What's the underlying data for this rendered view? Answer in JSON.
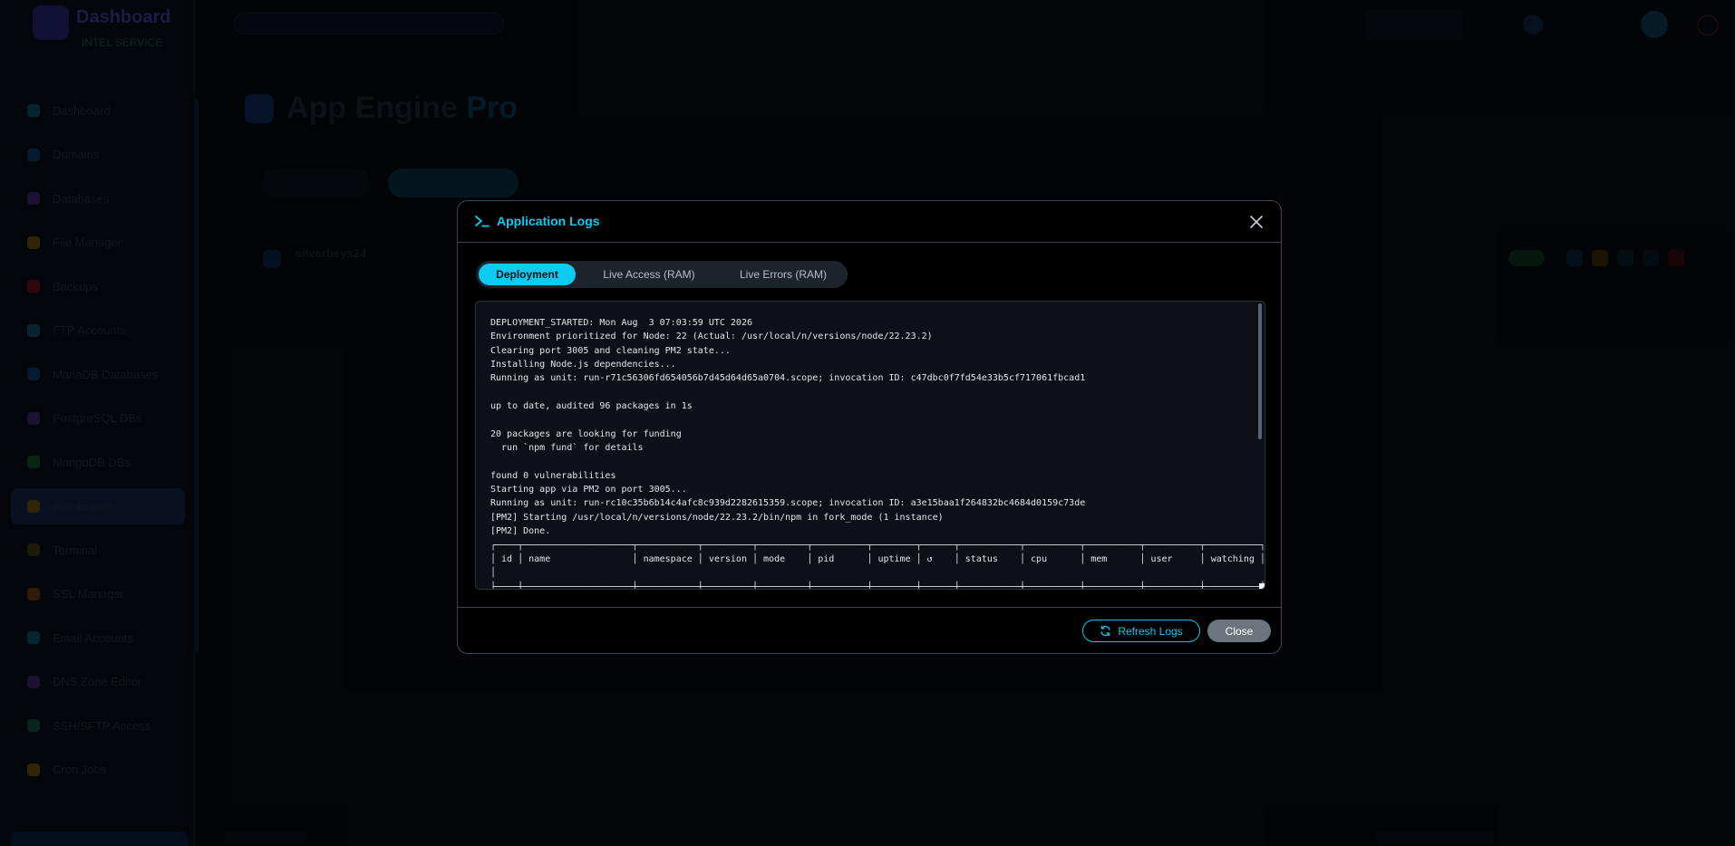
{
  "background": {
    "brand_name": "Dashboard",
    "brand_sub": "INTEL SERVICE",
    "sidebar_items": [
      {
        "label": "Dashboard",
        "color": "#0b3a4a"
      },
      {
        "label": "Domains",
        "color": "#0b2a4a"
      },
      {
        "label": "Databases",
        "color": "#2a1b4a"
      },
      {
        "label": "File Manager",
        "color": "#4a3a0b"
      },
      {
        "label": "Backups",
        "color": "#4a0b14"
      },
      {
        "label": "FTP Accounts",
        "color": "#0b3a4a"
      },
      {
        "label": "MariaDB Databases",
        "color": "#0b2a4a"
      },
      {
        "label": "PostgreSQL DBs",
        "color": "#2a1b4a"
      },
      {
        "label": "MongoDB DBs",
        "color": "#0b3a1b"
      },
      {
        "label": "App Engine",
        "color": "#4a3a0b",
        "active": true
      },
      {
        "label": "Terminal",
        "color": "#2a2a0b"
      },
      {
        "label": "SSL Manager",
        "color": "#4a2a0b"
      },
      {
        "label": "Email Accounts",
        "color": "#0b3a4a"
      },
      {
        "label": "DNS Zone Editor",
        "color": "#2a1b4a"
      },
      {
        "label": "SSH/SFTP Access",
        "color": "#0b3a2a"
      },
      {
        "label": "Cron Jobs",
        "color": "#4a3a0b"
      }
    ],
    "page_title": "App Engine",
    "page_title_suffix": "Pro",
    "app_name": "silverbeys24"
  },
  "modal": {
    "title": "Application Logs",
    "tabs": [
      {
        "label": "Deployment",
        "active": true
      },
      {
        "label": "Live Access (RAM)",
        "active": false
      },
      {
        "label": "Live Errors (RAM)",
        "active": false
      }
    ],
    "log_text": "DEPLOYMENT_STARTED: Mon Aug  3 07:03:59 UTC 2026\nEnvironment prioritized for Node: 22 (Actual: /usr/local/n/versions/node/22.23.2)\nClearing port 3005 and cleaning PM2 state...\nInstalling Node.js dependencies...\nRunning as unit: run-r71c56306fd654056b7d45d64d65a0704.scope; invocation ID: c47dbc0f7fd54e33b5cf717061fbcad1\n\nup to date, audited 96 packages in 1s\n\n20 packages are looking for funding\n  run `npm fund` for details\n\nfound 0 vulnerabilities\nStarting app via PM2 on port 3005...\nRunning as unit: run-rc10c35b6b14c4afc8c939d2282615359.scope; invocation ID: a3e15baa1f264832bc4684d0159c73de\n[PM2] Starting /usr/local/n/versions/node/22.23.2/bin/npm in fork_mode (1 instance)\n[PM2] Done.\n┌────┬────────────────────┬───────────┬─────────┬─────────┬──────────┬────────┬──────┬───────────┬──────────┬──────────┬──────────┬──────────┐\n│ id │ name               │ namespace │ version │ mode    │ pid      │ uptime │ ↺    │ status    │ cpu      │ mem      │ user     │ watching │\n│\n├────┼────────────────────┼───────────┼─────────┼─────────┼──────────┼────────┼──────┼───────────┼──────────┼──────────┼──────────┼──────────┤",
    "refresh_label": "Refresh Logs",
    "close_label": "Close",
    "accent_color": "#0dcaf0"
  }
}
